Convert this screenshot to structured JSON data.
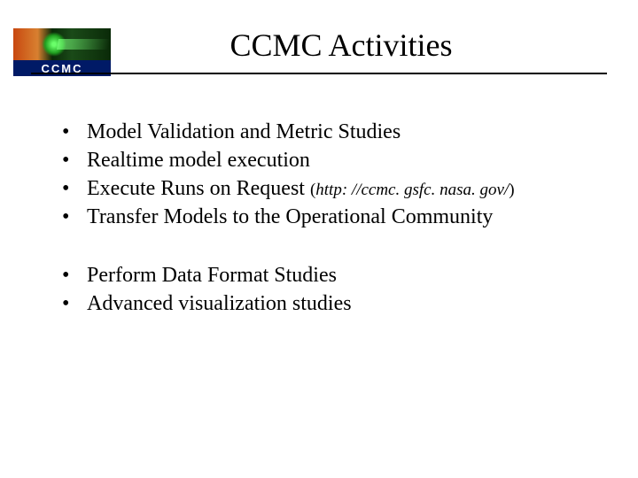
{
  "logo": {
    "label": "CCMC"
  },
  "title": "CCMC Activities",
  "bulletsGroup1": {
    "item0": "Model Validation and Metric Studies",
    "item1": "Realtime model execution",
    "item2_prefix": "Execute Runs on Request ",
    "item2_paren_open": "(",
    "item2_url": "http: //ccmc. gsfc. nasa. gov/",
    "item2_paren_close": ")",
    "item3": "Transfer Models to the Operational Community"
  },
  "bulletsGroup2": {
    "item0": "Perform Data Format Studies",
    "item1": "Advanced visualization studies"
  }
}
